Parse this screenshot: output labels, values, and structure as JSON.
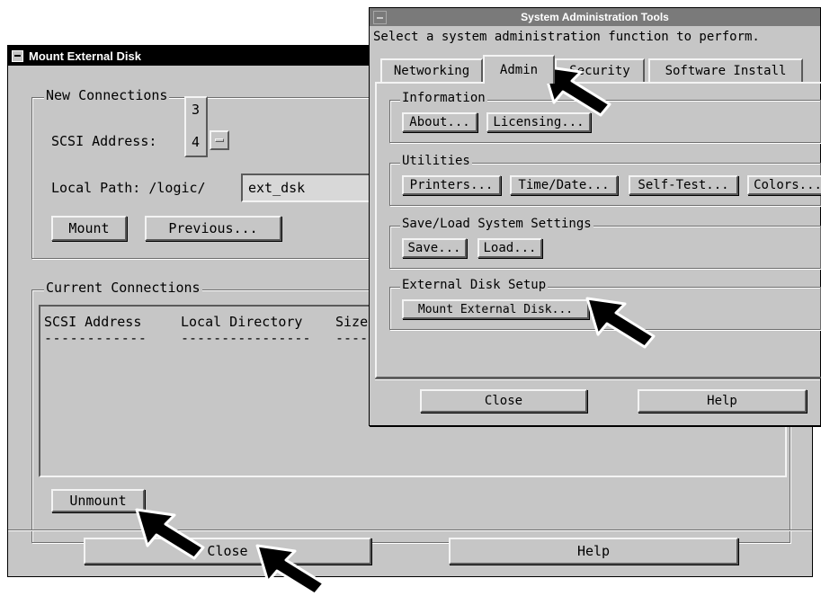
{
  "mount_window": {
    "title": "Mount External Disk",
    "new_connections": {
      "legend": "New Connections",
      "scsi_label": "SCSI Address:",
      "scsi_value": "4",
      "scsi_option_above": "3",
      "local_path_label": "Local Path: /logic/",
      "local_path_value": "ext_dsk",
      "mount_label": "Mount",
      "previous_label": "Previous..."
    },
    "current_connections": {
      "legend": "Current Connections",
      "columns": [
        "SCSI Address",
        "Local Directory",
        "Size"
      ],
      "rule": "------------",
      "rule_long": "----------------",
      "rule_short": "----",
      "unmount_label": "Unmount"
    },
    "footer": {
      "close_label": "Close",
      "help_label": "Help"
    }
  },
  "sys_window": {
    "title": "System Administration Tools",
    "prompt": "Select a system administration function to perform.",
    "tabs": [
      {
        "label": "Networking",
        "active": false
      },
      {
        "label": "Admin",
        "active": true
      },
      {
        "label": "Security",
        "active": false
      },
      {
        "label": "Software Install",
        "active": false
      }
    ],
    "groups": {
      "information": {
        "legend": "Information",
        "buttons": [
          "About...",
          "Licensing..."
        ]
      },
      "utilities": {
        "legend": "Utilities",
        "buttons": [
          "Printers...",
          "Time/Date...",
          "Self-Test...",
          "Colors..."
        ]
      },
      "save_load": {
        "legend": "Save/Load System Settings",
        "buttons": [
          "Save...",
          "Load..."
        ]
      },
      "external_disk": {
        "legend": "External Disk Setup",
        "buttons": [
          "Mount External Disk..."
        ]
      }
    },
    "footer": {
      "close_label": "Close",
      "help_label": "Help"
    }
  },
  "icons": {
    "window_menu": "window-menu-icon",
    "option_menu": "option-menu-icon",
    "pointer": "pointer-arrow-icon"
  },
  "colors": {
    "window_bg": "#c6c6c6",
    "active_title": "#000000",
    "inactive_title": "#7a7a7a"
  }
}
